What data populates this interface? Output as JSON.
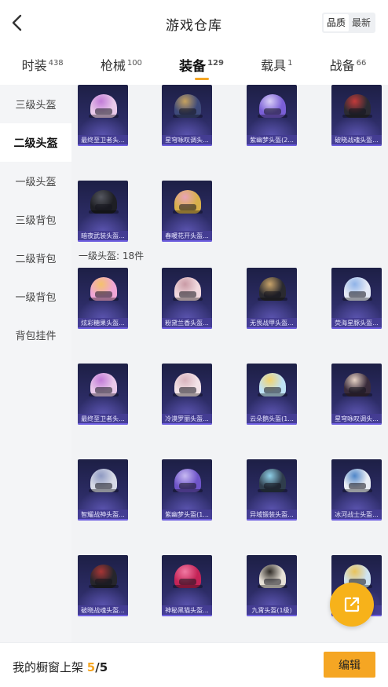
{
  "header": {
    "title": "游戏仓库",
    "sort_options": [
      "品质",
      "最新"
    ],
    "sort_active": 0
  },
  "tabs": [
    {
      "label": "时装",
      "count": "438"
    },
    {
      "label": "枪械",
      "count": "100"
    },
    {
      "label": "装备",
      "count": "129",
      "active": true
    },
    {
      "label": "载具",
      "count": "1"
    },
    {
      "label": "战备",
      "count": "66"
    }
  ],
  "sidebar": {
    "items": [
      {
        "label": "三级头盔"
      },
      {
        "label": "二级头盔",
        "active": true
      },
      {
        "label": "一级头盔"
      },
      {
        "label": "三级背包"
      },
      {
        "label": "二级背包"
      },
      {
        "label": "一级背包"
      },
      {
        "label": "背包挂件"
      }
    ]
  },
  "level2_items": [
    {
      "name": "最终至卫者头...",
      "color": "#e9c9ea",
      "accent": "#c27bd8"
    },
    {
      "name": "星穹咏叹调头...",
      "color": "#3e4a7a",
      "accent": "#c7a25e"
    },
    {
      "name": "紫幽梦头盔(2...",
      "color": "#7a5fd6",
      "accent": "#d9cff7"
    },
    {
      "name": "破晓战魂头盔...",
      "color": "#2b2b33",
      "accent": "#c23a3a"
    },
    {
      "name": "暗夜武装头盔...",
      "color": "#1e1f24",
      "accent": "#555760"
    },
    {
      "name": "春暖花开头盔...",
      "color": "#d8b04a",
      "accent": "#e9a3b8"
    }
  ],
  "level1_section": {
    "label": "一级头盔: 18件"
  },
  "level1_items": [
    {
      "name": "炫彩糖果头盔...",
      "color": "#f0a6d6",
      "accent": "#f5c26b"
    },
    {
      "name": "粉黛兰香头盔...",
      "color": "#f1d9de",
      "accent": "#c99aa5"
    },
    {
      "name": "无畏战甲头盔...",
      "color": "#2a2a30",
      "accent": "#c9a46a"
    },
    {
      "name": "荧海星豚头盔...",
      "color": "#e4e9f5",
      "accent": "#8fb3e8"
    },
    {
      "name": "最终至卫者头...",
      "color": "#e9c9ea",
      "accent": "#c27bd8"
    },
    {
      "name": "冷漠罗丽头盔...",
      "color": "#f3e3e8",
      "accent": "#d9b3bd"
    },
    {
      "name": "云朵鹅头盔(1...",
      "color": "#bfe2f5",
      "accent": "#f3d36c"
    },
    {
      "name": "星穹咏叹调头...",
      "color": "#3a2c3c",
      "accent": "#e7d3c5"
    },
    {
      "name": "智耀战神头盔...",
      "color": "#d7dae6",
      "accent": "#8e99c2"
    },
    {
      "name": "紫幽梦头盔(1...",
      "color": "#6f55c9",
      "accent": "#c7baf2"
    },
    {
      "name": "异域锻装头盔...",
      "color": "#2f3d4c",
      "accent": "#8fd0e8"
    },
    {
      "name": "冰河战士头盔...",
      "color": "#e9edf3",
      "accent": "#4f86c9"
    },
    {
      "name": "破晓战魂头盔...",
      "color": "#26262c",
      "accent": "#a83535"
    },
    {
      "name": "神秘黑猫头盔...",
      "color": "#c42457",
      "accent": "#f17aa3"
    },
    {
      "name": "九霄头盔(1级)",
      "color": "#e7e1d7",
      "accent": "#2f2b26"
    },
    {
      "name": "",
      "color": "#cfe3f0",
      "accent": "#e9c35a"
    }
  ],
  "bottom_bar": {
    "label": "我的橱窗上架",
    "count": "5",
    "separator": "/",
    "total": "5",
    "edit_label": "编辑"
  }
}
